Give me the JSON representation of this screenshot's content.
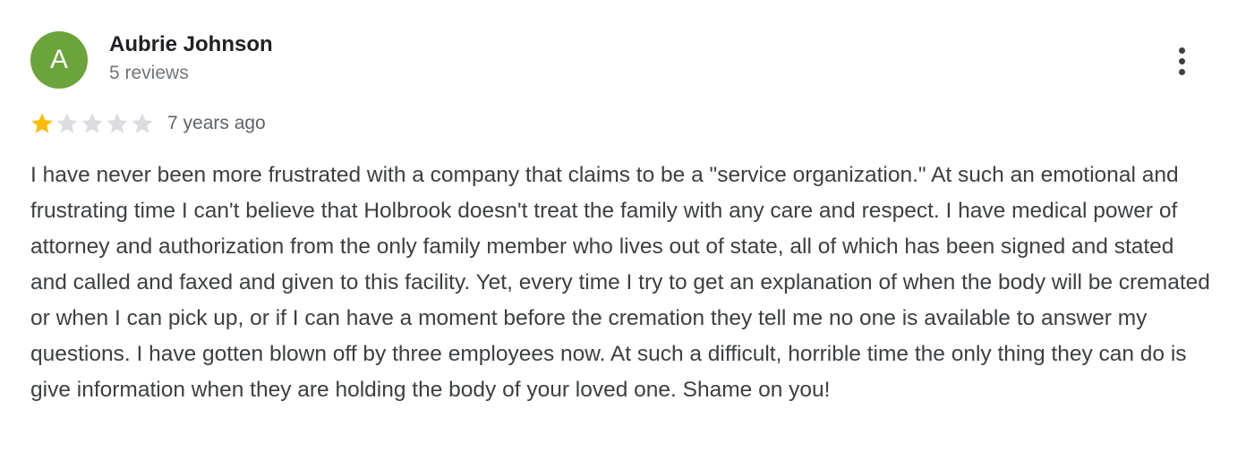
{
  "review": {
    "avatar_initial": "A",
    "avatar_color": "#6aa43a",
    "author_name": "Aubrie Johnson",
    "review_count": "5 reviews",
    "rating": 1,
    "max_rating": 5,
    "star_filled_color": "#fbbc04",
    "star_empty_color": "#dadce0",
    "time_ago": "7 years ago",
    "text": "I have never been more frustrated with a company that claims to be a \"service organization.\" At such an emotional and frustrating time I can't believe that Holbrook doesn't treat the family with any care and respect. I have medical power of attorney and authorization from the only family member who lives out of state, all of which has been signed and stated and called and faxed and given to this facility. Yet, every time I try to get an explanation of when the body will be cremated or when I can pick up, or if I can have a moment before the cremation they tell me no one is available to answer my questions. I have gotten blown off by three employees now. At such a difficult, horrible time the only thing they can do is give information when they are holding the body of your loved one. Shame on you!",
    "more_icon": "more-vert-icon"
  }
}
